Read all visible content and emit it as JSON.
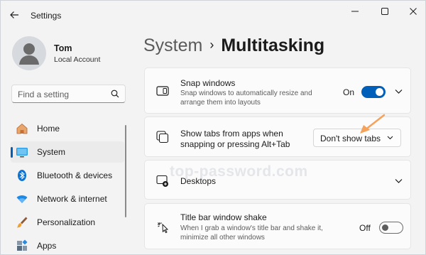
{
  "window": {
    "title": "Settings",
    "controls": [
      "minimize",
      "maximize",
      "close"
    ]
  },
  "user": {
    "name": "Tom",
    "account_type": "Local Account"
  },
  "search": {
    "placeholder": "Find a setting"
  },
  "nav": {
    "items": [
      {
        "label": "Home",
        "icon": "home-icon"
      },
      {
        "label": "System",
        "icon": "system-icon",
        "active": true
      },
      {
        "label": "Bluetooth & devices",
        "icon": "bluetooth-icon"
      },
      {
        "label": "Network & internet",
        "icon": "wifi-icon"
      },
      {
        "label": "Personalization",
        "icon": "brush-icon"
      },
      {
        "label": "Apps",
        "icon": "apps-icon"
      }
    ]
  },
  "breadcrumb": {
    "parent": "System",
    "separator": "›",
    "current": "Multitasking"
  },
  "settings": {
    "snap_windows": {
      "title": "Snap windows",
      "description_line1": "Snap windows to automatically resize and",
      "description_line2": "arrange them into layouts",
      "state_label": "On",
      "enabled": true
    },
    "show_tabs": {
      "title_line1": "Show tabs from apps when",
      "title_line2": "snapping or pressing Alt+Tab",
      "selected_option": "Don't show tabs"
    },
    "desktops": {
      "title": "Desktops"
    },
    "title_bar_shake": {
      "title": "Title bar window shake",
      "description_line1": "When I grab a window's title bar and shake it,",
      "description_line2": "minimize all other windows",
      "state_label": "Off",
      "enabled": false
    }
  },
  "watermark": "top-password.com",
  "colors": {
    "accent": "#005fb8",
    "annotation_arrow": "#f5a25b",
    "background": "#f3f3f3",
    "card": "#fbfbfb"
  }
}
